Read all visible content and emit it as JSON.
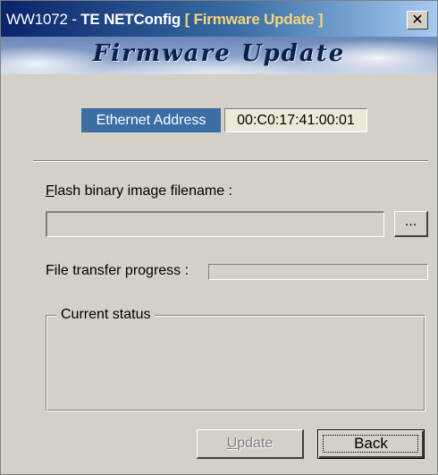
{
  "window": {
    "title_app": "WW1072 - ",
    "title_main": "TE NETConfig ",
    "title_section": "[ Firmware Update ]",
    "close_label": "✕"
  },
  "banner": {
    "heading": "Firmware Update"
  },
  "ethernet": {
    "label": "Ethernet Address",
    "value": "00:C0:17:41:00:01"
  },
  "flash": {
    "label_access_key": "F",
    "label_rest": "lash binary image filename :",
    "filename_value": "",
    "browse_label": "..."
  },
  "progress": {
    "label": "File transfer progress :",
    "fraction": 0
  },
  "status": {
    "legend": "Current status",
    "text": ""
  },
  "buttons": {
    "update_access_key": "U",
    "update_rest": "pdate",
    "update_enabled": false,
    "back_label": "Back"
  },
  "colors": {
    "window_background": "#d4d0c8",
    "title_bar_start": "#0a246a",
    "title_bar_end": "#a6caf0",
    "ethernet_label_background": "#3a6ea5",
    "disabled_text": "#808080"
  }
}
